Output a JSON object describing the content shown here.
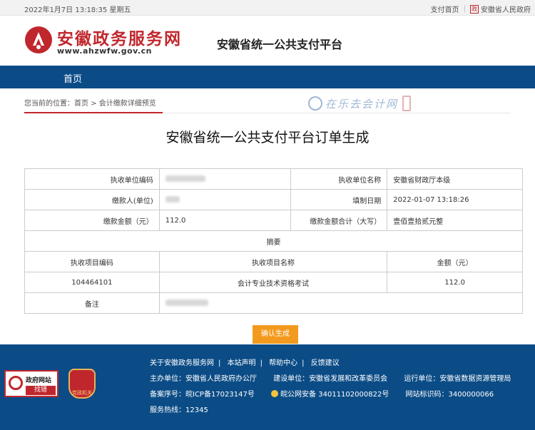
{
  "topbar": {
    "datetime": "2022年1月7日 13:18:35 星期五",
    "pay_home": "支付首页",
    "gov_link": "安徽省人民政府",
    "gov_badge": "政"
  },
  "header": {
    "site_name": "安徽政务服务网",
    "site_url": "www.ahzwfw.gov.cn",
    "platform_title": "安徽省统一公共支付平台"
  },
  "nav": {
    "home": "首页"
  },
  "breadcrumb": {
    "text": "您当前的位置：首页 > 会计缴款详细预览",
    "watermark": "在乐去会计网"
  },
  "page_title": "安徽省统一公共支付平台订单生成",
  "bill": {
    "row1": {
      "label_a": "执收单位编码",
      "value_a": "",
      "label_b": "执收单位名称",
      "value_b": "安徽省财政厅本级"
    },
    "row2": {
      "label_a": "缴款人(单位)",
      "value_a": "",
      "label_b": "填制日期",
      "value_b": "2022-01-07 13:18:26"
    },
    "row3": {
      "label_a": "缴款金额（元）",
      "value_a": "112.0",
      "label_b": "缴款金额合计（大写）",
      "value_b": "壹佰壹拾贰元整"
    },
    "summary_header": "摘要",
    "columns": [
      "执收项目编码",
      "执收项目名称",
      "金额（元）"
    ],
    "item": {
      "code": "104464101",
      "name": "会计专业技术资格考试",
      "amount": "112.0"
    },
    "remark_label": "备注",
    "remark_value": ""
  },
  "confirm_button": "确认生成",
  "footer": {
    "badge_line1": "政府网站",
    "badge_line2": "找错",
    "emblem_text": "党政机关",
    "links": [
      "关于安徽政务服务网",
      "本站声明",
      "帮助中心",
      "反馈建议"
    ],
    "host_label": "主办单位：",
    "host": "安徽省人民政府办公厅",
    "builder_label": "建设单位：",
    "builder": "安徽省发展和改革委员会",
    "operator_label": "运行单位：",
    "operator": "安徽省数据资源管理局",
    "icp_label": "备案序号：",
    "icp": "皖ICP备17023147号",
    "police_record": "皖公网安备 34011102000822号",
    "site_id_label": "网站标识码：",
    "site_id": "3400000066",
    "hotline_label": "服务热线：",
    "hotline": "12345"
  },
  "colors": {
    "brand_red": "#c0272d",
    "nav_blue": "#0b4c86",
    "button_orange": "#f39a1e"
  }
}
